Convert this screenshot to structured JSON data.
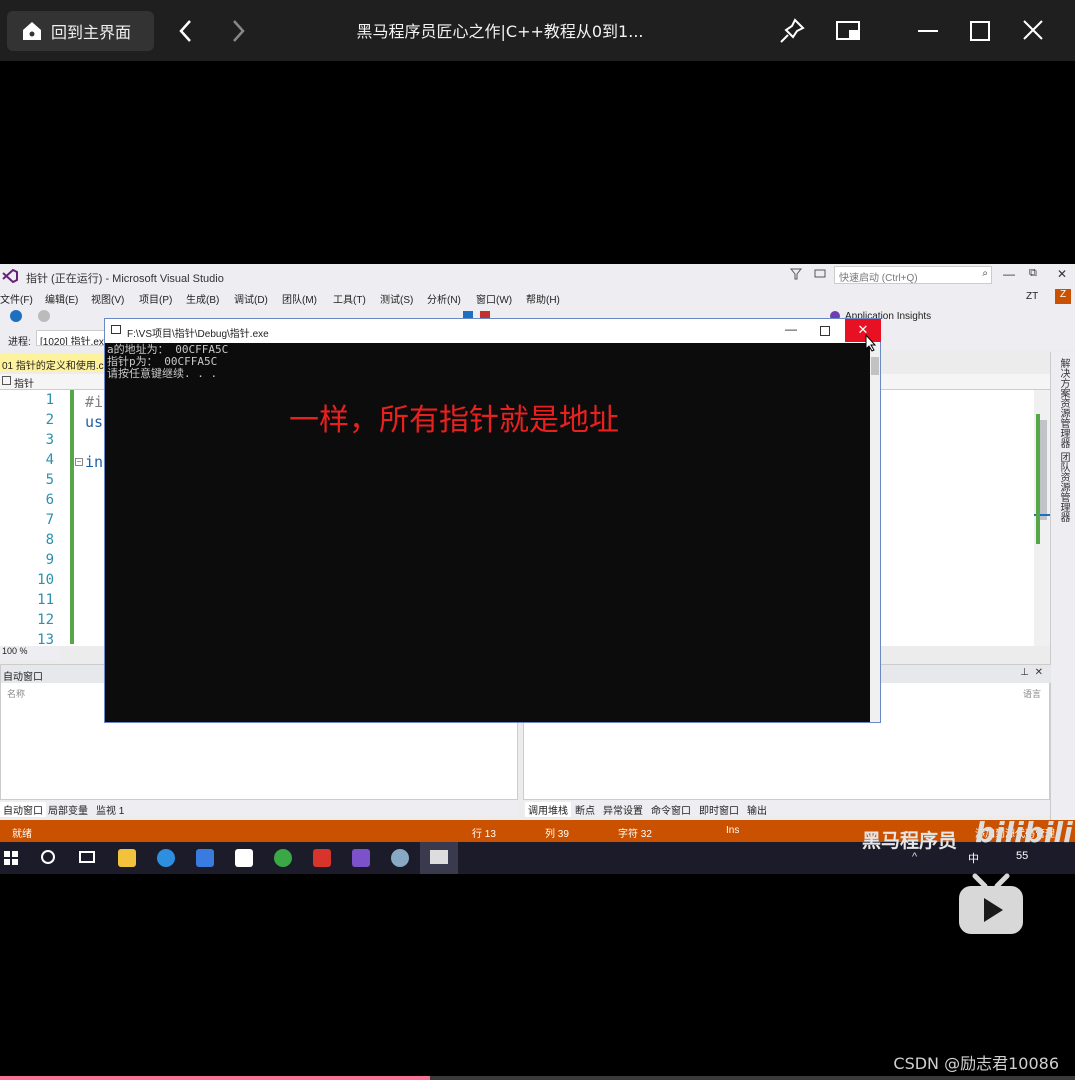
{
  "player": {
    "home_label": "回到主界面",
    "title": "黑马程序员匠心之作|C++教程从0到1...",
    "progress": 0.4
  },
  "vs": {
    "window_title": "指针 (正在运行) - Microsoft Visual Studio",
    "quick_launch_placeholder": "快速启动 (Ctrl+Q)",
    "user": "ZT",
    "menu": [
      "文件(F)",
      "编辑(E)",
      "视图(V)",
      "项目(P)",
      "生成(B)",
      "调试(D)",
      "团队(M)",
      "工具(T)",
      "测试(S)",
      "分析(N)",
      "窗口(W)",
      "帮助(H)"
    ],
    "app_insights": "Application Insights",
    "process_label": "进程:",
    "process_value": "[1020] 指针.exe",
    "doc_tab": "01 指针的定义和使用.cpp",
    "nav_scope": "指针",
    "line_numbers": [
      "1",
      "2",
      "3",
      "4",
      "5",
      "6",
      "7",
      "8",
      "9",
      "10",
      "11",
      "12",
      "13"
    ],
    "code_fragments": [
      "#i",
      "us",
      "in"
    ],
    "zoom": "100 %",
    "right_dock": [
      "解决方案资源管理器",
      "团队资源管理器"
    ],
    "auto_pane_title": "自动窗口",
    "auto_col_name": "名称",
    "call_col_lang": "语言",
    "tabs_left": [
      "自动窗口",
      "局部变量",
      "监视 1"
    ],
    "tabs_right": [
      "调用堆栈",
      "断点",
      "异常设置",
      "命令窗口",
      "即时窗口",
      "输出"
    ],
    "status": {
      "ready": "就绪",
      "row": "行 13",
      "col": "列 39",
      "char": "字符 32",
      "mode": "Ins",
      "source_control": "添加到源代码管理"
    }
  },
  "console": {
    "title": "F:\\VS项目\\指针\\Debug\\指针.exe",
    "lines": [
      "a的地址为： 00CFFA5C",
      "指针p为： 00CFFA5C",
      "请按任意键继续. . ."
    ],
    "close_glyph": "✕"
  },
  "subtitle": "一样，所有指针就是地址",
  "taskbar": {
    "tray_lang": "中",
    "tray_badge": "55"
  },
  "watermarks": {
    "brand": "黑马程序员",
    "bilibili": "bilibili",
    "csdn": "CSDN @励志君10086"
  },
  "colors": {
    "vs_status": "#ca5100",
    "console_bg": "#0c0c0c",
    "subtitle": "#e8201e",
    "close_red": "#e81123"
  }
}
